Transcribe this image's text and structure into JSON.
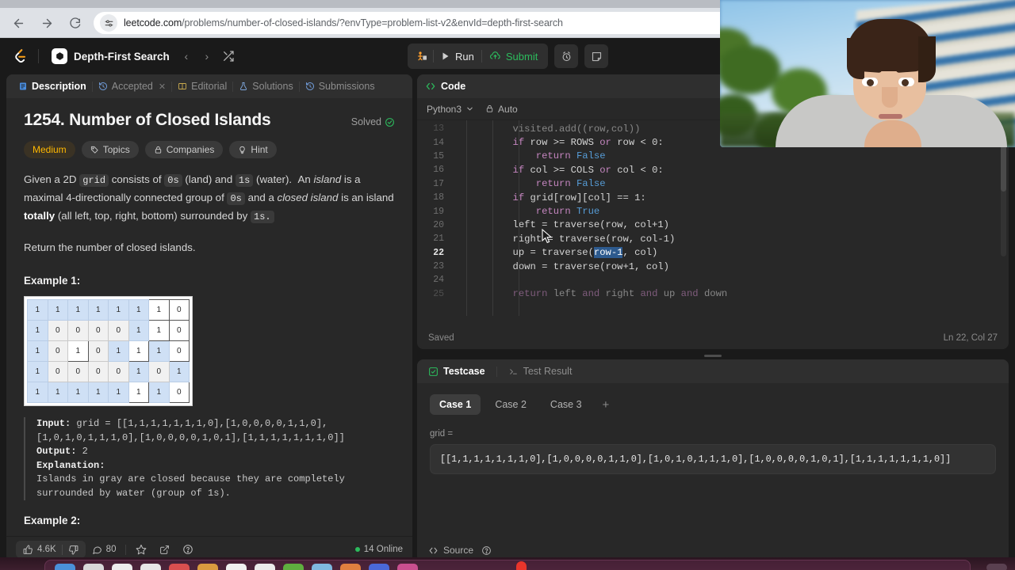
{
  "browser": {
    "back_icon": "back-arrow-icon",
    "forward_icon": "forward-arrow-icon",
    "reload_icon": "reload-icon",
    "site_settings_icon": "site-settings-icon",
    "url_domain": "leetcode.com",
    "url_path": "/problems/number-of-closed-islands/?envType=problem-list-v2&envId=depth-first-search"
  },
  "header": {
    "logo": "leetcode-logo",
    "topic_label": "Depth-First Search",
    "prev_label": "‹",
    "next_label": "›",
    "shuffle_icon": "shuffle-icon",
    "debug_label": "debug-icon",
    "run_label": "Run",
    "submit_label": "Submit",
    "timer_icon": "timer-icon",
    "note_icon": "note-icon"
  },
  "description_panel": {
    "tabs": [
      {
        "label": "Description",
        "icon": "document-icon",
        "active": true
      },
      {
        "label": "Accepted",
        "icon": "history-icon",
        "active": false,
        "closable": true
      },
      {
        "label": "Editorial",
        "icon": "book-icon",
        "active": false
      },
      {
        "label": "Solutions",
        "icon": "flask-icon",
        "active": false
      },
      {
        "label": "Submissions",
        "icon": "history-icon",
        "active": false
      }
    ],
    "title": "1254. Number of Closed Islands",
    "solved_label": "Solved",
    "badges": [
      {
        "label": "Medium",
        "kind": "difficulty"
      },
      {
        "label": "Topics",
        "icon": "tag-icon"
      },
      {
        "label": "Companies",
        "icon": "lock-icon"
      },
      {
        "label": "Hint",
        "icon": "bulb-icon"
      }
    ],
    "paragraph2": "Return the number of closed islands.",
    "example1_heading": "Example 1:",
    "example2_heading": "Example 2:",
    "example1_input_label": "Input:",
    "example1_input_line1": "grid = [[1,1,1,1,1,1,1,0],[1,0,0,0,0,1,1,0],",
    "example1_input_line2": "[1,0,1,0,1,1,1,0],[1,0,0,0,0,1,0,1],[1,1,1,1,1,1,1,0]]",
    "example1_output_label": "Output:",
    "example1_output_value": "2",
    "example1_explanation_label": "Explanation:",
    "example1_explanation_line1": "Islands in gray are closed because they are completely",
    "example1_explanation_line2": "surrounded by water (group of 1s).",
    "grid_image": {
      "rows": [
        [
          {
            "v": "1",
            "s": "b"
          },
          {
            "v": "1",
            "s": "b"
          },
          {
            "v": "1",
            "s": "b"
          },
          {
            "v": "1",
            "s": "b"
          },
          {
            "v": "1",
            "s": "b"
          },
          {
            "v": "1",
            "s": "b"
          },
          {
            "v": "1",
            "s": "w"
          },
          {
            "v": "0",
            "s": "w"
          }
        ],
        [
          {
            "v": "1",
            "s": "b"
          },
          {
            "v": "0",
            "s": "g"
          },
          {
            "v": "0",
            "s": "g"
          },
          {
            "v": "0",
            "s": "g"
          },
          {
            "v": "0",
            "s": "g"
          },
          {
            "v": "1",
            "s": "b"
          },
          {
            "v": "1",
            "s": "w"
          },
          {
            "v": "0",
            "s": "w"
          }
        ],
        [
          {
            "v": "1",
            "s": "b"
          },
          {
            "v": "0",
            "s": "g"
          },
          {
            "v": "1",
            "s": "w"
          },
          {
            "v": "0",
            "s": "g"
          },
          {
            "v": "1",
            "s": "b"
          },
          {
            "v": "1",
            "s": "w"
          },
          {
            "v": "1",
            "s": "b"
          },
          {
            "v": "0",
            "s": "w"
          }
        ],
        [
          {
            "v": "1",
            "s": "b"
          },
          {
            "v": "0",
            "s": "g"
          },
          {
            "v": "0",
            "s": "g"
          },
          {
            "v": "0",
            "s": "g"
          },
          {
            "v": "0",
            "s": "g"
          },
          {
            "v": "1",
            "s": "b"
          },
          {
            "v": "0",
            "s": "g"
          },
          {
            "v": "1",
            "s": "b"
          }
        ],
        [
          {
            "v": "1",
            "s": "b"
          },
          {
            "v": "1",
            "s": "b"
          },
          {
            "v": "1",
            "s": "b"
          },
          {
            "v": "1",
            "s": "b"
          },
          {
            "v": "1",
            "s": "b"
          },
          {
            "v": "1",
            "s": "w"
          },
          {
            "v": "1",
            "s": "b"
          },
          {
            "v": "0",
            "s": "w"
          }
        ]
      ]
    },
    "footer": {
      "upvote_count": "4.6K",
      "upvote_icon": "thumbs-up-icon",
      "downvote_icon": "thumbs-down-icon",
      "comment_count": "80",
      "comment_icon": "comment-icon",
      "star_icon": "star-icon",
      "share_icon": "share-icon",
      "help_icon": "help-icon",
      "online_label": "14 Online"
    }
  },
  "code_panel": {
    "tab_label": "Code",
    "tab_icon": "code-icon",
    "language": "Python3",
    "chevron_icon": "chevron-down-icon",
    "auto_label": "Auto",
    "lock_icon": "lock-icon",
    "lines": [
      {
        "no": "13",
        "text": "        visited.add((row,col))",
        "partial": true
      },
      {
        "no": "14",
        "text": "        if row >= ROWS or row < 0:"
      },
      {
        "no": "15",
        "text": "            return False"
      },
      {
        "no": "16",
        "text": "        if col >= COLS or col < 0:"
      },
      {
        "no": "17",
        "text": "            return False"
      },
      {
        "no": "18",
        "text": "        if grid[row][col] == 1:"
      },
      {
        "no": "19",
        "text": "            return True"
      },
      {
        "no": "20",
        "text": "        left = traverse(row, col+1)"
      },
      {
        "no": "21",
        "text": "        right = traverse(row, col-1)"
      },
      {
        "no": "22",
        "text": "        up = traverse(row-1, col)",
        "current": true
      },
      {
        "no": "23",
        "text": "        down = traverse(row+1, col)"
      },
      {
        "no": "24",
        "text": ""
      },
      {
        "no": "25",
        "text": "        return left and right and up and down",
        "partial": true
      }
    ],
    "saved_label": "Saved",
    "cursor_position": "Ln 22, Col 27",
    "selection_text": "row-1"
  },
  "testcase_panel": {
    "tabs": [
      {
        "label": "Testcase",
        "icon": "checkbox-icon",
        "active": true
      },
      {
        "label": "Test Result",
        "icon": "terminal-icon",
        "active": false
      }
    ],
    "cases": [
      {
        "label": "Case 1",
        "active": true
      },
      {
        "label": "Case 2",
        "active": false
      },
      {
        "label": "Case 3",
        "active": false
      }
    ],
    "add_case_label": "+",
    "input_label": "grid =",
    "input_value": "[[1,1,1,1,1,1,1,0],[1,0,0,0,0,1,1,0],[1,0,1,0,1,1,1,0],[1,0,0,0,0,1,0,1],[1,1,1,1,1,1,1,0]]",
    "footer": {
      "source_label": "Source",
      "source_icon": "code-icon",
      "help_icon": "help-icon"
    }
  },
  "webcam": {
    "label": "webcam-overlay"
  },
  "dock": {
    "icons": [
      "dock-icon-1",
      "dock-icon-2",
      "dock-icon-3",
      "dock-icon-4",
      "dock-icon-5",
      "dock-icon-6",
      "dock-icon-7",
      "dock-icon-8",
      "dock-icon-9",
      "dock-icon-10",
      "dock-icon-11",
      "dock-icon-12",
      "dock-icon-13"
    ]
  },
  "colors": {
    "accent_green": "#2cbb5d",
    "difficulty_medium": "#ffb800",
    "panel_bg": "#282828",
    "selection_blue": "#2d5a8e"
  }
}
